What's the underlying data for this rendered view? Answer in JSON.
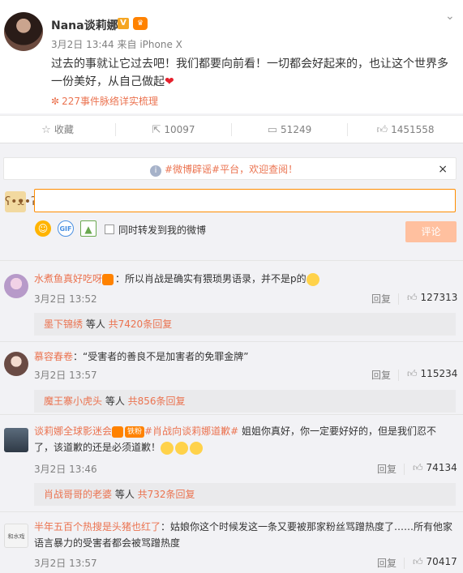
{
  "post": {
    "author": "Nana谈莉娜",
    "verified_badge": "V",
    "member_badge": "♛",
    "time": "3月2日 13:44",
    "source_prefix": "来自",
    "source": "iPhone X",
    "text_line1": "过去的事就让它过去吧！我们都要向前看！一切都会好起来的，也让这个世界多",
    "text_line2": "一份美好，从自己做起",
    "topic": "227事件脉络详实梳理"
  },
  "actions": {
    "favorite_label": "收藏",
    "forward_count": "10097",
    "comment_count": "51249",
    "like_count": "1451558"
  },
  "notice": {
    "text": "#微博辟谣#平台，欢迎查阅！",
    "close": "×"
  },
  "compose": {
    "placeholder": "",
    "forward_label": "同时转发到我的微博",
    "submit_label": "评论",
    "gif_label": "GIF"
  },
  "comments": [
    {
      "user": "水煮鱼真好吃呀",
      "text": "：所以肖战是确实有猥琐男语录，并不是p的",
      "time": "3月2日 13:52",
      "reply_label": "回复",
      "likes": "127313",
      "sub_user": "墨下锦绣",
      "sub_mid": " 等人 ",
      "sub_count": "共7420条回复"
    },
    {
      "user": "慕容春卷",
      "text": "：“受害者的善良不是加害者的免罪金牌”",
      "time": "3月2日 13:57",
      "reply_label": "回复",
      "likes": "115234",
      "sub_user": "魔王寨小虎头",
      "sub_mid": " 等人 ",
      "sub_count": "共856条回复"
    },
    {
      "user": "谈莉娜全球影迷会",
      "fan_badge": "铁粉",
      "topic": "#肖战向谈莉娜道歉#",
      "text_line1": " 姐姐你真好，你一定要好好的，但是我们忍不",
      "text_line2": "了，该道歉的还是必须道歉！",
      "time": "3月2日 13:46",
      "reply_label": "回复",
      "likes": "74134",
      "sub_user": "肖战哥哥的老婆",
      "sub_mid": " 等人 ",
      "sub_count": "共732条回复"
    },
    {
      "user": "半年五百个热搜是头猪也红了",
      "text_line1": "：姑娘你这个时候发这一条又要被那家粉丝骂蹭热度了……所有他家",
      "text_line2": "语言暴力的受害者都会被骂蹭热度",
      "time": "3月2日 13:57",
      "reply_label": "回复",
      "likes": "70417",
      "avatar_text": "和水戏"
    }
  ]
}
